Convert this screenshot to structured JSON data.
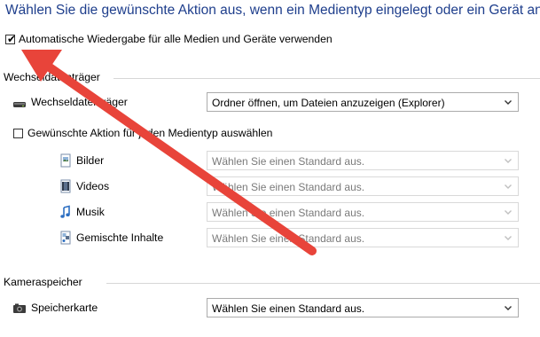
{
  "heading": "Wählen Sie die gewünschte Aktion aus, wenn ein Medientyp eingelegt oder ein Gerät ang",
  "autoplay": {
    "label": "Automatische Wiedergabe für alle Medien und Geräte verwenden",
    "checked": true
  },
  "removable_section": {
    "title": "Wechseldatenträger",
    "device": {
      "label": "Wechseldatenträger",
      "value": "Ordner öffnen, um Dateien anzuzeigen (Explorer)"
    },
    "per_media": {
      "label": "Gewünschte Aktion für jeden Medientyp auswählen",
      "checked": false,
      "items": [
        {
          "label": "Bilder",
          "value": "Wählen Sie einen Standard aus.",
          "icon": "picture-icon"
        },
        {
          "label": "Videos",
          "value": "Wählen Sie einen Standard aus.",
          "icon": "video-icon"
        },
        {
          "label": "Musik",
          "value": "Wählen Sie einen Standard aus.",
          "icon": "music-icon"
        },
        {
          "label": "Gemischte Inhalte",
          "value": "Wählen Sie einen Standard aus.",
          "icon": "mixed-content-icon"
        }
      ]
    }
  },
  "camera_section": {
    "title": "Kameraspeicher",
    "memory_card": {
      "label": "Speicherkarte",
      "value": "Wählen Sie einen Standard aus."
    }
  },
  "colors": {
    "heading": "#1e3e8c",
    "annotation_arrow": "#e8443a"
  }
}
